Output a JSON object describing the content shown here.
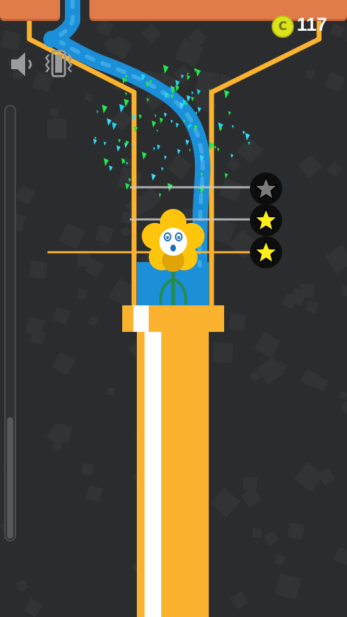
{
  "coins": {
    "symbol": "C",
    "count": "117"
  },
  "controls": {
    "sound_icon": "speaker-muted-icon",
    "vibration_icon": "phone-vibrate-icon"
  },
  "level_progress": 0.28,
  "star_thresholds": [
    {
      "name": "star-line-1",
      "filled": false
    },
    {
      "name": "star-line-2",
      "filled": true
    },
    {
      "name": "star-line-3",
      "filled": true
    }
  ],
  "colors": {
    "background": "#2a2c2e",
    "pipe": "#fbb32f",
    "water": "#1b8fd8",
    "water_light": "#4ab4ee",
    "brick": "#e07b4a",
    "coin": "#dde31a",
    "flower": "#ffc40c",
    "star_filled": "#ffee1a",
    "star_empty": "#7a7a7a"
  }
}
